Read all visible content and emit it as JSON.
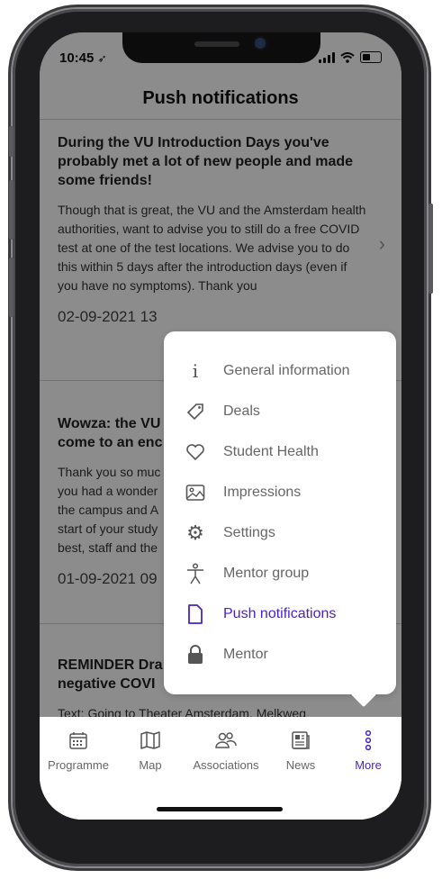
{
  "status_bar": {
    "time": "10:45"
  },
  "header": {
    "title": "Push notifications"
  },
  "notifications": [
    {
      "title": "During the VU Introduction Days you've probably met a lot of new people and made some friends!",
      "body": "Though that is great, the VU and the Amsterdam health authorities, want to advise you to still do a free COVID test at one of the test locations. We advise you to do this within 5 days after the introduction days (even if you have no symptoms). Thank you",
      "date": "02-09-2021 13"
    },
    {
      "title": "Wowza: the VU",
      "title2": "come to an enc",
      "body_lines": [
        "Thank you so muc",
        "you had a wonder",
        "the campus and A",
        "start of your study",
        "best, staff and the"
      ],
      "date": "01-09-2021 09"
    },
    {
      "title": "REMINDER Dra",
      "title2": "negative COVI",
      "body": "Text: Going to Theater Amsterdam, Melkweg"
    }
  ],
  "more_menu": {
    "items": [
      {
        "label": "General information",
        "icon": "info-icon",
        "active": false
      },
      {
        "label": "Deals",
        "icon": "tag-icon",
        "active": false
      },
      {
        "label": "Student Health",
        "icon": "heart-icon",
        "active": false
      },
      {
        "label": "Impressions",
        "icon": "image-icon",
        "active": false
      },
      {
        "label": "Settings",
        "icon": "gear-icon",
        "active": false
      },
      {
        "label": "Mentor group",
        "icon": "person-icon",
        "active": false
      },
      {
        "label": "Push notifications",
        "icon": "document-icon",
        "active": true
      },
      {
        "label": "Mentor",
        "icon": "lock-icon",
        "active": false
      }
    ]
  },
  "tab_bar": {
    "tabs": [
      {
        "label": "Programme",
        "icon": "calendar-icon",
        "active": false
      },
      {
        "label": "Map",
        "icon": "map-icon",
        "active": false
      },
      {
        "label": "Associations",
        "icon": "people-icon",
        "active": false
      },
      {
        "label": "News",
        "icon": "news-icon",
        "active": false
      },
      {
        "label": "More",
        "icon": "more-dots-icon",
        "active": true
      }
    ]
  },
  "colors": {
    "accent": "#4a22c9",
    "overlay": "#00000073"
  }
}
